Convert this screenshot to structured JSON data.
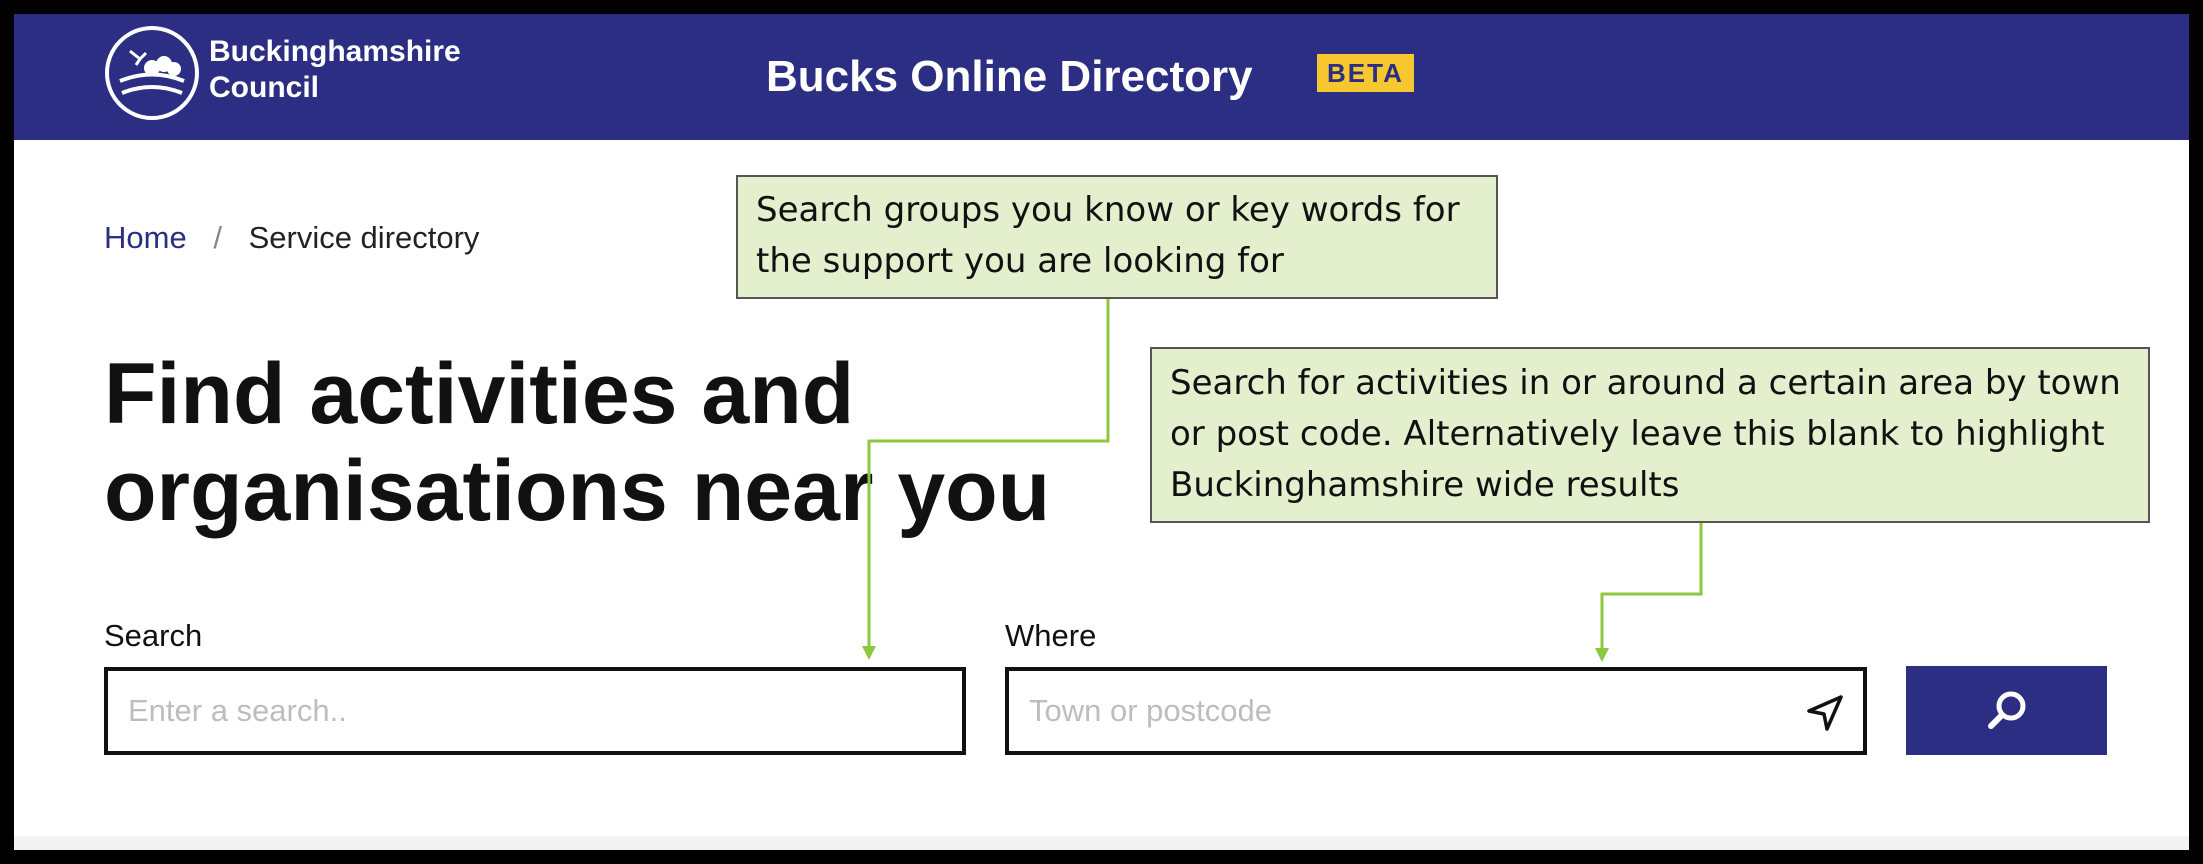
{
  "header": {
    "logo_text_line1": "Buckinghamshire",
    "logo_text_line2": "Council",
    "site_title": "Bucks Online Directory",
    "beta_badge": "BETA"
  },
  "breadcrumb": {
    "home": "Home",
    "separator": "/",
    "current": "Service directory"
  },
  "page": {
    "heading_line1": "Find activities and",
    "heading_line2": "organisations near you"
  },
  "search_form": {
    "search_label": "Search",
    "search_placeholder": "Enter a search..",
    "search_value": "",
    "where_label": "Where",
    "where_placeholder": "Town or postcode",
    "where_value": "",
    "location_icon": "navigation-arrow-icon",
    "submit_icon": "search-icon"
  },
  "callouts": {
    "search_hint_line1": "Search groups you know or key words for",
    "search_hint_line2": "the support you are looking for",
    "where_hint_line1": "Search for activities in or around a certain area by town",
    "where_hint_line2": "or post code. Alternatively leave this blank to highlight",
    "where_hint_line3": "Buckinghamshire wide results"
  },
  "colors": {
    "brand_navy": "#2b2e82",
    "beta_yellow": "#f7c72f",
    "callout_fill": "#e3efcd",
    "connector_green": "#8dc63f"
  }
}
